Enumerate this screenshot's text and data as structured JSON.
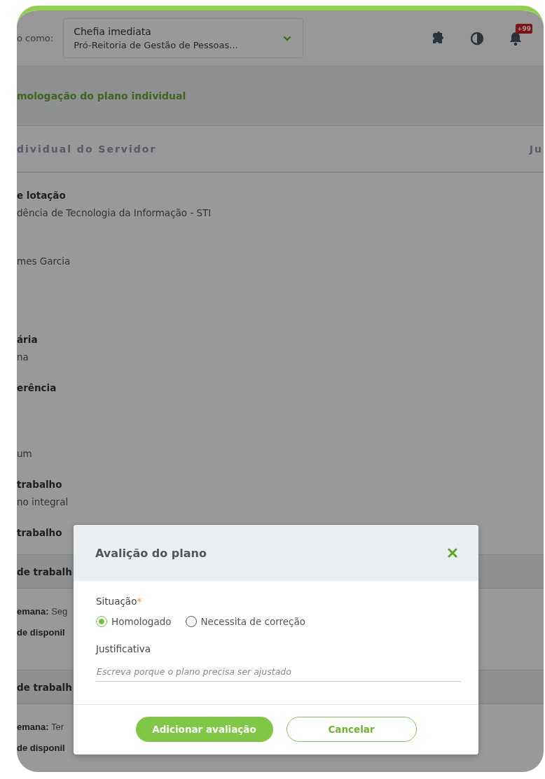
{
  "header": {
    "context_label": "o como:",
    "profile_select": {
      "role": "Chefia imediata",
      "unit": "Pró-Reitoria de Gestão de Pessoas..."
    },
    "notification_badge": "+99"
  },
  "breadcrumb": "mologação do plano individual",
  "tabs": [
    {
      "label": "dividual do Servidor"
    },
    {
      "label": "Ju"
    }
  ],
  "fields": [
    {
      "label": "e lotação",
      "value": "dência de Tecnologia da Informação - STI"
    },
    {
      "value": "mes Garcia"
    },
    {
      "label": "ária",
      "value": "na"
    },
    {
      "label": "erência"
    },
    {
      "value": "um"
    },
    {
      "label": "trabalho",
      "value": "no integral"
    },
    {
      "label": "trabalho"
    }
  ],
  "sections": [
    {
      "title": "de trabalh",
      "rows": [
        "**emana:** Seg",
        "**de disponil**"
      ]
    },
    {
      "title": "de trabalh",
      "rows": [
        "**emana:** Ter",
        "**de disponil**"
      ]
    }
  ],
  "modal": {
    "title": "Avalição do plano",
    "situation": {
      "label": "Situação",
      "required_mark": "*",
      "options": [
        {
          "label": "Homologado",
          "selected": true
        },
        {
          "label": "Necessita de correção",
          "selected": false
        }
      ]
    },
    "justification": {
      "label": "Justificativa",
      "placeholder": "Escreva porque o plano precisa ser ajustado"
    },
    "buttons": [
      {
        "label": "Adicionar avaliação",
        "kind": "primary"
      },
      {
        "label": "Cancelar",
        "kind": "secondary"
      }
    ]
  }
}
